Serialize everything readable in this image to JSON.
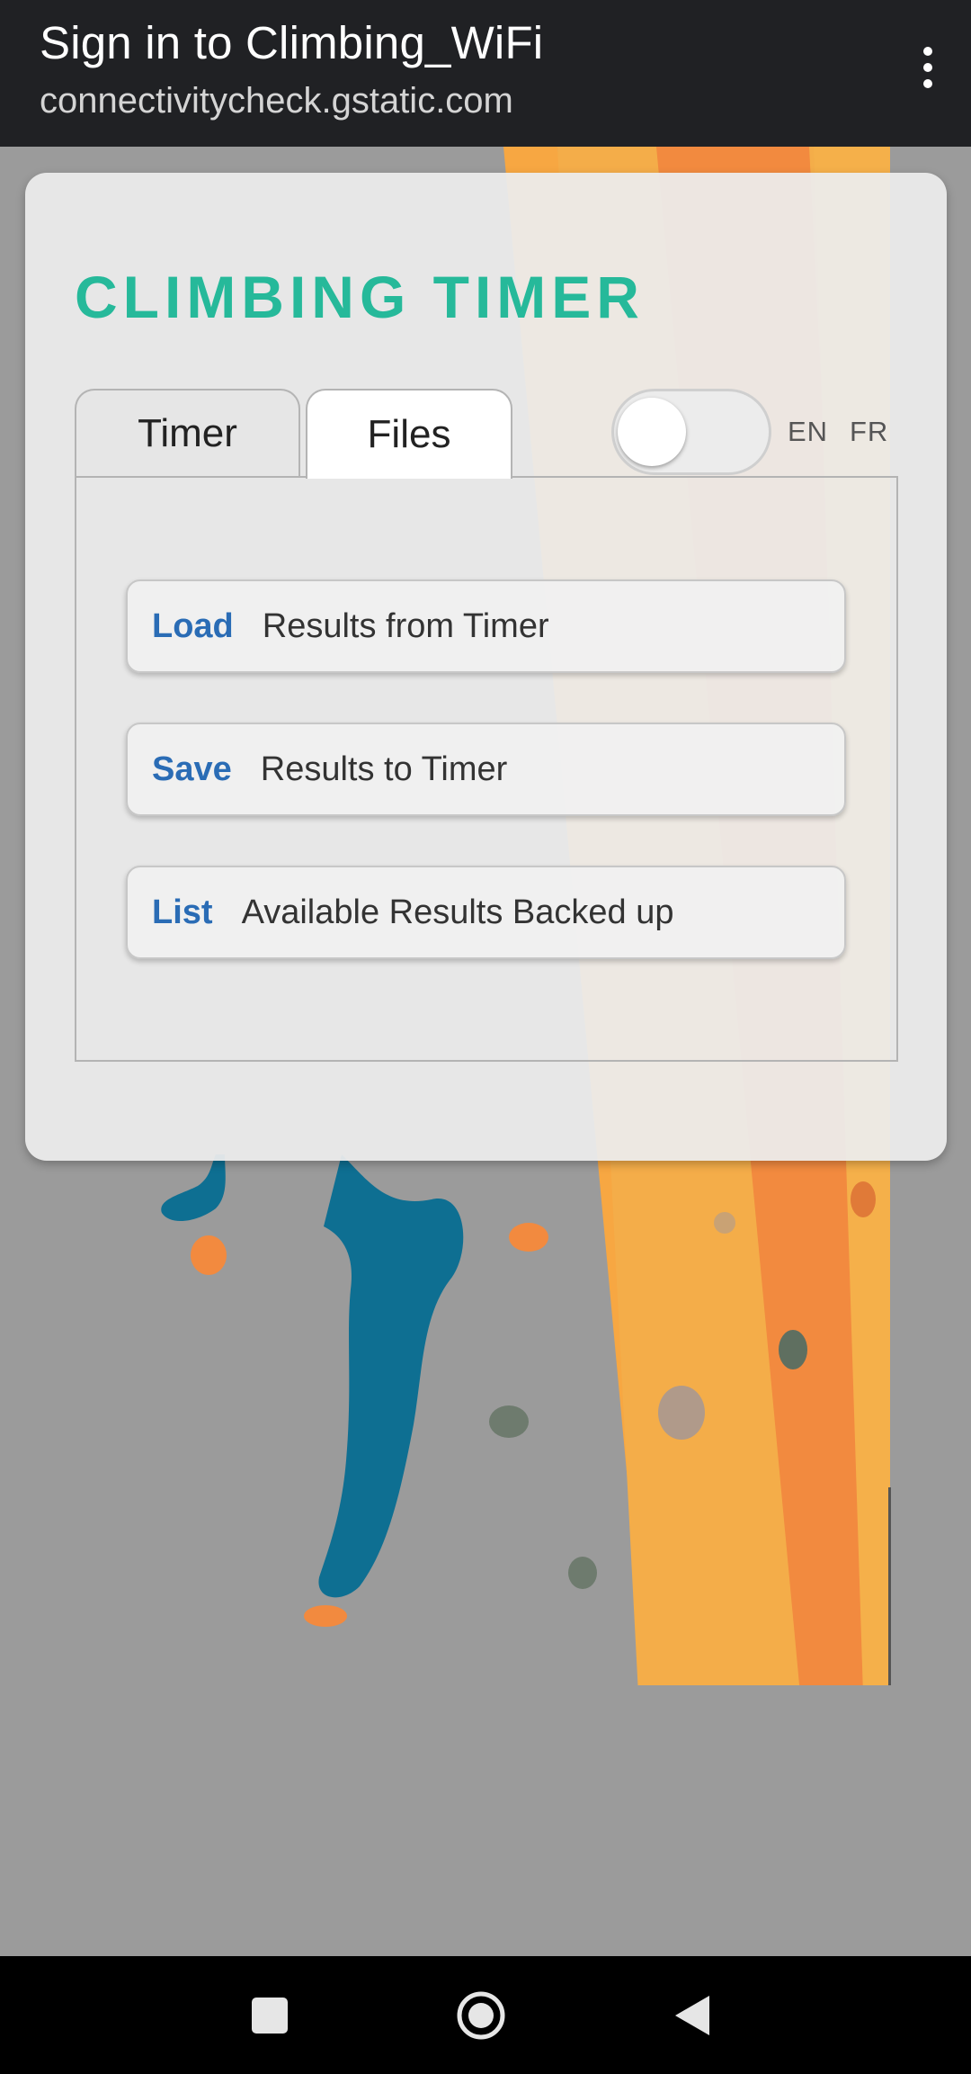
{
  "app_bar": {
    "title": "Sign in to Climbing_WiFi",
    "subtitle": "connectivitycheck.gstatic.com",
    "menu_icon": "more-vert-icon"
  },
  "card": {
    "title": "CLIMBING TIMER",
    "tabs": [
      {
        "label": "Timer",
        "selected": false
      },
      {
        "label": "Files",
        "selected": true
      }
    ],
    "toggle": {
      "state": "off"
    },
    "languages": [
      "EN",
      "FR"
    ],
    "actions": [
      {
        "verb": "Load",
        "description": "Results from Timer"
      },
      {
        "verb": "Save",
        "description": "Results to Timer"
      },
      {
        "verb": "List",
        "description": "Available Results Backed up"
      }
    ]
  },
  "nav_bar": {
    "buttons": [
      "recent-apps-icon",
      "home-icon",
      "back-icon"
    ]
  },
  "colors": {
    "accent": "#26b99a",
    "action_verb": "#2a6cb5",
    "app_bar": "#202124",
    "background": "#9b9b9b"
  }
}
